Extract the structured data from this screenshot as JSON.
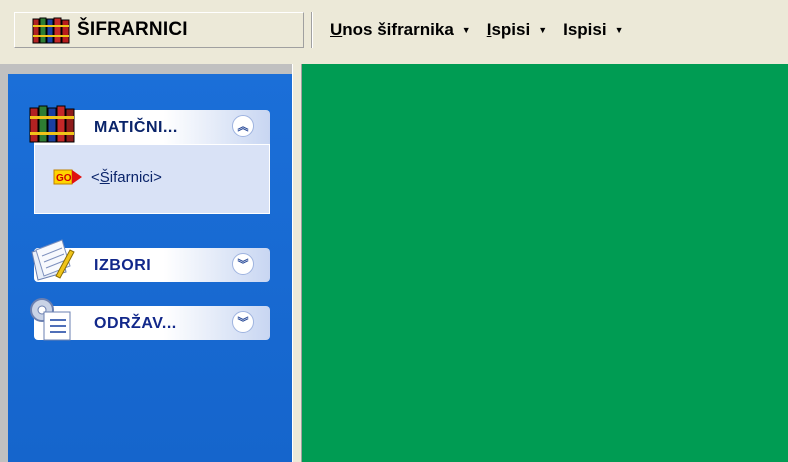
{
  "header": {
    "title": "ŠIFRARNICI"
  },
  "menu": {
    "items": [
      {
        "accel": "U",
        "rest": "nos šifrarnika"
      },
      {
        "accel": "I",
        "rest": "spisi"
      },
      {
        "accel": "",
        "rest": "Ispisi"
      }
    ]
  },
  "sidebar": {
    "groups": [
      {
        "label": "MATIČNI...",
        "expanded": true,
        "icon": "books-icon",
        "items": [
          {
            "prefix": "<",
            "accel": "Š",
            "rest": "ifarnici>",
            "icon": "go-icon"
          }
        ]
      },
      {
        "label": "IZBORI",
        "expanded": false,
        "icon": "notes-icon"
      },
      {
        "label": "ODRŽAV...",
        "expanded": false,
        "icon": "maintenance-icon"
      }
    ]
  },
  "colors": {
    "sidebar_bg": "#1b6fd8",
    "content_bg": "#009c53",
    "group_text": "#0a246a"
  }
}
